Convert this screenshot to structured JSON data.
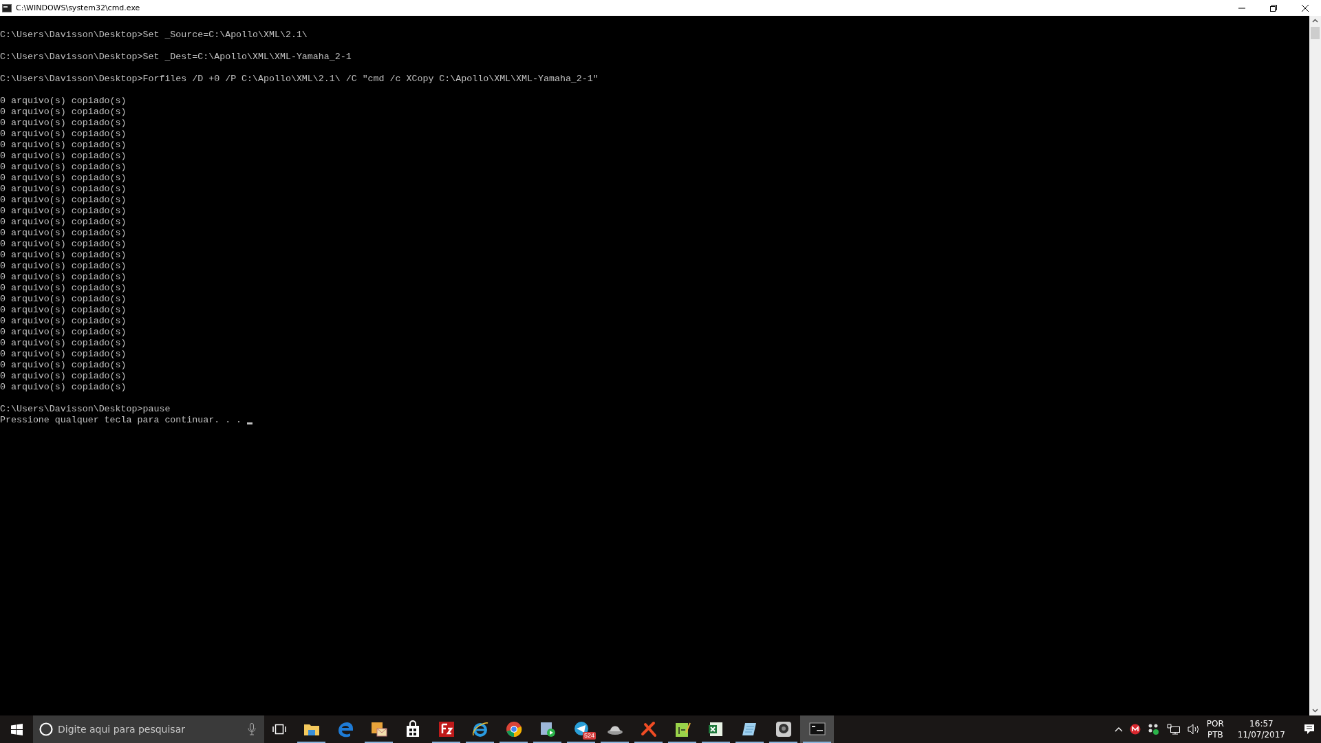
{
  "window": {
    "title": "C:\\WINDOWS\\system32\\cmd.exe"
  },
  "console": {
    "blocks": [
      [
        "C:\\Users\\Davisson\\Desktop>Set _Source=C:\\Apollo\\XML\\2.1\\"
      ],
      [
        "C:\\Users\\Davisson\\Desktop>Set _Dest=C:\\Apollo\\XML\\XML-Yamaha_2-1"
      ],
      [
        "C:\\Users\\Davisson\\Desktop>Forfiles /D +0 /P C:\\Apollo\\XML\\2.1\\ /C \"cmd /c XCopy C:\\Apollo\\XML\\XML-Yamaha_2-1\""
      ],
      [
        "0 arquivo(s) copiado(s)",
        "0 arquivo(s) copiado(s)",
        "0 arquivo(s) copiado(s)",
        "0 arquivo(s) copiado(s)",
        "0 arquivo(s) copiado(s)",
        "0 arquivo(s) copiado(s)",
        "0 arquivo(s) copiado(s)",
        "0 arquivo(s) copiado(s)",
        "0 arquivo(s) copiado(s)",
        "0 arquivo(s) copiado(s)",
        "0 arquivo(s) copiado(s)",
        "0 arquivo(s) copiado(s)",
        "0 arquivo(s) copiado(s)",
        "0 arquivo(s) copiado(s)",
        "0 arquivo(s) copiado(s)",
        "0 arquivo(s) copiado(s)",
        "0 arquivo(s) copiado(s)",
        "0 arquivo(s) copiado(s)",
        "0 arquivo(s) copiado(s)",
        "0 arquivo(s) copiado(s)",
        "0 arquivo(s) copiado(s)",
        "0 arquivo(s) copiado(s)",
        "0 arquivo(s) copiado(s)",
        "0 arquivo(s) copiado(s)",
        "0 arquivo(s) copiado(s)",
        "0 arquivo(s) copiado(s)",
        "0 arquivo(s) copiado(s)"
      ],
      [
        "C:\\Users\\Davisson\\Desktop>pause",
        "Pressione qualquer tecla para continuar. . . "
      ]
    ]
  },
  "taskbar": {
    "search": {
      "placeholder": "Digite aqui para pesquisar"
    },
    "apps": [
      {
        "kind": "folder",
        "running": true,
        "selected": false
      },
      {
        "kind": "edge",
        "running": false,
        "selected": false
      },
      {
        "kind": "mail",
        "running": true,
        "selected": false
      },
      {
        "kind": "store",
        "running": false,
        "selected": false
      },
      {
        "kind": "fz",
        "running": true,
        "selected": false
      },
      {
        "kind": "ie",
        "running": true,
        "selected": false
      },
      {
        "kind": "chrome",
        "running": true,
        "selected": false
      },
      {
        "kind": "player",
        "running": true,
        "selected": false
      },
      {
        "kind": "plane",
        "running": true,
        "selected": false,
        "badge": "524"
      },
      {
        "kind": "hat",
        "running": true,
        "selected": false
      },
      {
        "kind": "bolt",
        "running": true,
        "selected": false
      },
      {
        "kind": "notepadpp",
        "running": true,
        "selected": false
      },
      {
        "kind": "sheet",
        "running": true,
        "selected": false
      },
      {
        "kind": "notepad",
        "running": true,
        "selected": false
      },
      {
        "kind": "camera",
        "running": true,
        "selected": false
      },
      {
        "kind": "terminal",
        "running": true,
        "selected": true
      }
    ],
    "language": [
      "POR",
      "PTB"
    ],
    "time": "16:57",
    "date": "11/07/2017"
  }
}
